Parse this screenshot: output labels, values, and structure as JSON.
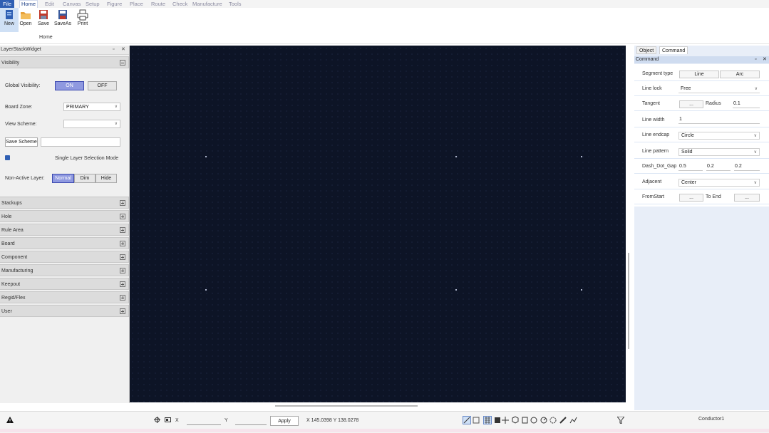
{
  "menu": {
    "file": "File",
    "items": [
      "Home",
      "Edit",
      "Canvas",
      "Setup",
      "Figure",
      "Place",
      "Route",
      "Check",
      "Manufacture",
      "Tools"
    ],
    "active": "Home"
  },
  "ribbon": {
    "buttons": [
      {
        "label": "New",
        "icon": "new-file-icon"
      },
      {
        "label": "Open",
        "icon": "open-folder-icon"
      },
      {
        "label": "Save",
        "icon": "save-icon"
      },
      {
        "label": "SaveAs",
        "icon": "save-as-icon"
      },
      {
        "label": "Print",
        "icon": "printer-icon"
      }
    ],
    "group_label": "Home"
  },
  "left_panel": {
    "title": "LayerStackWidget",
    "visibility_section": "Visibility",
    "global_visibility_label": "Global Visibility:",
    "on_label": "ON",
    "off_label": "OFF",
    "board_zone_label": "Board Zone:",
    "board_zone_value": "PRIMARY",
    "view_scheme_label": "View Scheme:",
    "view_scheme_value": "",
    "save_scheme_label": "Save Scheme",
    "single_layer_label": "Single Layer Selection Mode",
    "single_layer_checked": true,
    "non_active_label": "Non-Active Layer:",
    "non_active_options": [
      "Normal",
      "Dim",
      "Hide"
    ],
    "non_active_selected": "Normal",
    "sections": [
      "Stackups",
      "Hole",
      "Rule Area",
      "Board",
      "Component",
      "Manufacturing",
      "Keepout",
      "Regid/Flex",
      "User"
    ]
  },
  "right_panel": {
    "tabs": [
      "Object",
      "Command"
    ],
    "active_tab": "Command",
    "header": "Command",
    "segment_type_label": "Segment type",
    "segment_line": "Line",
    "segment_arc": "Arc",
    "line_lock_label": "Line lock",
    "line_lock_value": "Free",
    "tangent_label": "Tangent",
    "tangent_btn": "...",
    "radius_label": "Radius",
    "radius_value": "0.1",
    "line_width_label": "Line width",
    "line_width_value": "1",
    "line_endcap_label": "Line endcap",
    "line_endcap_value": "Circle",
    "line_pattern_label": "Line pattern",
    "line_pattern_value": "Solid",
    "dash_label": "Dash_Dot_Gap",
    "dash_values": [
      "0.5",
      "0.2",
      "0.2"
    ],
    "adjacent_label": "Adjacent",
    "adjacent_value": "Center",
    "fromstart_label": "FromStart",
    "fromstart_btn": "...",
    "toend_label": "To End",
    "toend_btn": "..."
  },
  "status_bar": {
    "x_label": "X",
    "y_label": "Y",
    "x_value": "",
    "y_value": "",
    "apply_label": "Apply",
    "coords": "X 145.0398 Y 138.0278",
    "layer": "Conductor1"
  },
  "colors": {
    "canvas_bg": "#0d1426",
    "accent": "#2f5fb3",
    "toggle_on": "#8f99e0"
  }
}
